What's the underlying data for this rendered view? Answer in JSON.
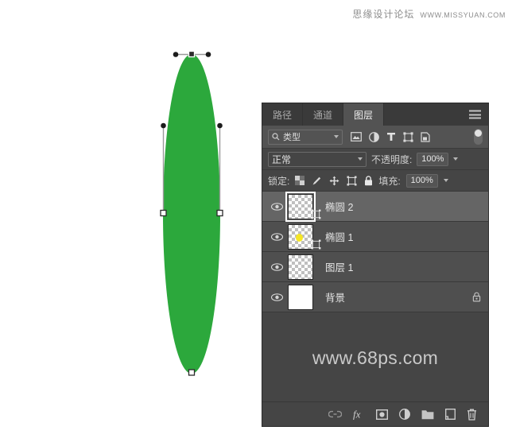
{
  "watermarks": {
    "top_cn": "思缘设计论坛",
    "top_en": "WWW.MISSYUAN.COM",
    "panel": "www.68ps.com"
  },
  "canvas": {
    "shape_name": "ellipse-vector-shape",
    "shape_fill": "#2ca83c",
    "background": "#ffffff"
  },
  "panel": {
    "tabs": [
      {
        "label": "路径",
        "active": false
      },
      {
        "label": "通道",
        "active": false
      },
      {
        "label": "图层",
        "active": true
      }
    ],
    "menu_icon": "hamburger-menu-icon",
    "filter": {
      "select_value": "类型",
      "search_icon": "search-icon",
      "icons": [
        "pixel-layer-filter-icon",
        "adjustment-layer-filter-icon",
        "type-layer-filter-icon",
        "shape-layer-filter-icon",
        "smart-object-filter-icon"
      ],
      "toggle": "filter-enable-toggle"
    },
    "blend": {
      "mode": "正常",
      "opacity_label": "不透明度:",
      "opacity_value": "100%"
    },
    "lock": {
      "label": "锁定:",
      "icons": [
        "lock-transparent-pixels-icon",
        "lock-image-pixels-icon",
        "lock-position-icon",
        "lock-artboard-nesting-icon",
        "lock-all-icon"
      ],
      "fill_label": "填充:",
      "fill_value": "100%"
    },
    "layers": [
      {
        "name": "椭圆",
        "suffix": " 2",
        "selected": true,
        "visible": true,
        "locked": false,
        "thumb_type": "transparent",
        "has_vector_badge": true
      },
      {
        "name": "椭圆",
        "suffix": " 1",
        "selected": false,
        "visible": true,
        "locked": false,
        "thumb_type": "transparent-dot",
        "has_vector_badge": true
      },
      {
        "name": "图层",
        "suffix": " 1",
        "selected": false,
        "visible": true,
        "locked": false,
        "thumb_type": "transparent",
        "has_vector_badge": false
      },
      {
        "name": "背景",
        "suffix": "",
        "selected": false,
        "visible": true,
        "locked": true,
        "thumb_type": "white",
        "has_vector_badge": false
      }
    ],
    "bottom_tools": [
      "link-layers-icon",
      "layer-style-fx-icon",
      "add-layer-mask-icon",
      "new-adjustment-layer-icon",
      "new-group-icon",
      "new-layer-icon",
      "delete-layer-icon"
    ]
  }
}
